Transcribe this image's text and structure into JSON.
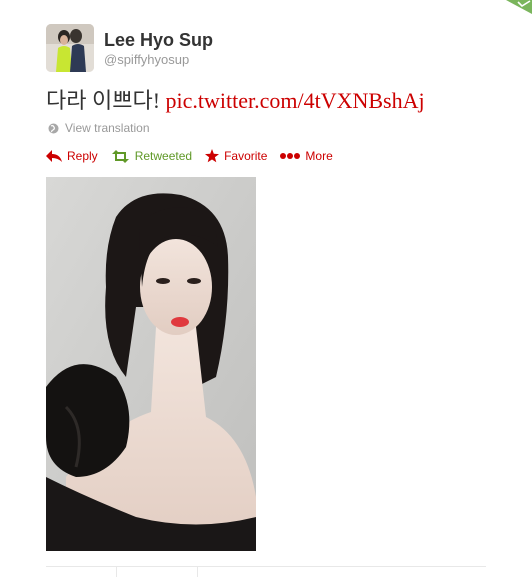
{
  "user": {
    "display_name": "Lee Hyo Sup",
    "handle": "@spiffyhyosup"
  },
  "tweet": {
    "text": "다라 이쁘다! ",
    "link": "pic.twitter.com/4tVXNBshAj"
  },
  "translate": {
    "label": "View translation",
    "icon": "globe-icon"
  },
  "actions": {
    "reply": "Reply",
    "retweeted": "Retweeted",
    "favorite": "Favorite",
    "more": "More"
  },
  "colors": {
    "action_red": "#cc0000",
    "retweeted_green": "#609928",
    "muted_gray": "#999999",
    "flag_green": "#6aa84f"
  }
}
